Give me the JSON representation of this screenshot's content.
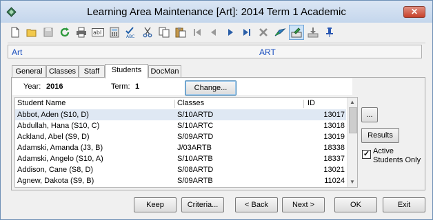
{
  "window": {
    "title": "Learning Area Maintenance  [Art]: 2014 Term 1 Academic",
    "close_glyph": "✕"
  },
  "pathbar": {
    "left": "Art",
    "right": "ART"
  },
  "tabs": [
    {
      "label": "General"
    },
    {
      "label": "Classes"
    },
    {
      "label": "Staff"
    },
    {
      "label": "Students",
      "active": true
    },
    {
      "label": "DocMan"
    }
  ],
  "info": {
    "year_label": "Year:",
    "year_value": "2016",
    "term_label": "Term:",
    "term_value": "1",
    "change_button": "Change..."
  },
  "grid": {
    "columns": [
      "Student Name",
      "Classes",
      "ID"
    ],
    "rows": [
      {
        "name": "Abbot, Aden (S10, D)",
        "classes": "S/10ARTD",
        "id": "13017",
        "selected": true
      },
      {
        "name": "Abdullah, Hana (S10, C)",
        "classes": "S/10ARTC",
        "id": "13018"
      },
      {
        "name": "Ackland, Abel (S9, D)",
        "classes": "S/09ARTD",
        "id": "13019"
      },
      {
        "name": "Adamski, Amanda (J3, B)",
        "classes": "J/03ARTB",
        "id": "18338"
      },
      {
        "name": "Adamski, Angelo (S10, A)",
        "classes": "S/10ARTB",
        "id": "18337"
      },
      {
        "name": "Addison, Cane (S8, D)",
        "classes": "S/08ARTD",
        "id": "13021"
      },
      {
        "name": "Agnew, Dakota (S9, B)",
        "classes": "S/09ARTB",
        "id": "11024"
      }
    ]
  },
  "side": {
    "ellipsis_button": "...",
    "results_button": "Results",
    "active_only_label_line1": "Active",
    "active_only_label_line2": "Students Only",
    "active_only_checked": true
  },
  "footer": {
    "keep": "Keep",
    "criteria": "Criteria...",
    "back": "< Back",
    "next": "Next >",
    "ok": "OK",
    "exit": "Exit"
  },
  "colors": {
    "link_blue": "#1a4fbf",
    "selection": "#dfe8f3",
    "titlebar": "#c4d6ec"
  },
  "toolbar_icons": [
    "new-document-icon",
    "open-folder-icon",
    "save-icon",
    "refresh-icon",
    "print-icon",
    "text-field-icon",
    "calculator-icon",
    "spell-check-icon",
    "cut-icon",
    "copy-icon",
    "paste-icon",
    "first-record-icon",
    "previous-record-icon",
    "next-record-icon",
    "last-record-icon",
    "delete-icon",
    "navigate-icon",
    "edit-record-icon",
    "import-icon",
    "pin-icon"
  ]
}
